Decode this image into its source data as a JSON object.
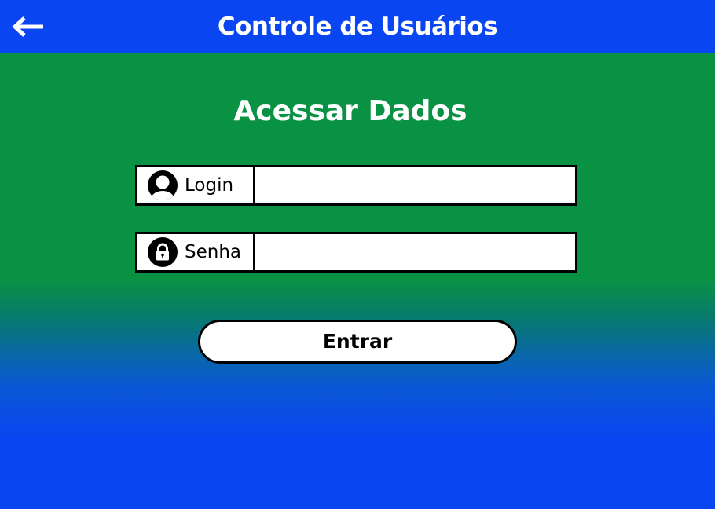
{
  "header": {
    "title": "Controle de Usuários",
    "back_icon": "arrow-left-icon"
  },
  "main": {
    "heading": "Acessar Dados",
    "fields": [
      {
        "label": "Login",
        "icon": "user-icon",
        "value": "",
        "placeholder": ""
      },
      {
        "label": "Senha",
        "icon": "lock-icon",
        "value": "",
        "placeholder": ""
      }
    ],
    "submit_label": "Entrar"
  },
  "colors": {
    "header_bg": "#0a45f2",
    "green_bg": "#0a9244",
    "blue_bg": "#0a45f2",
    "field_bg": "#ffffff",
    "border": "#000000",
    "text_light": "#ffffff"
  }
}
